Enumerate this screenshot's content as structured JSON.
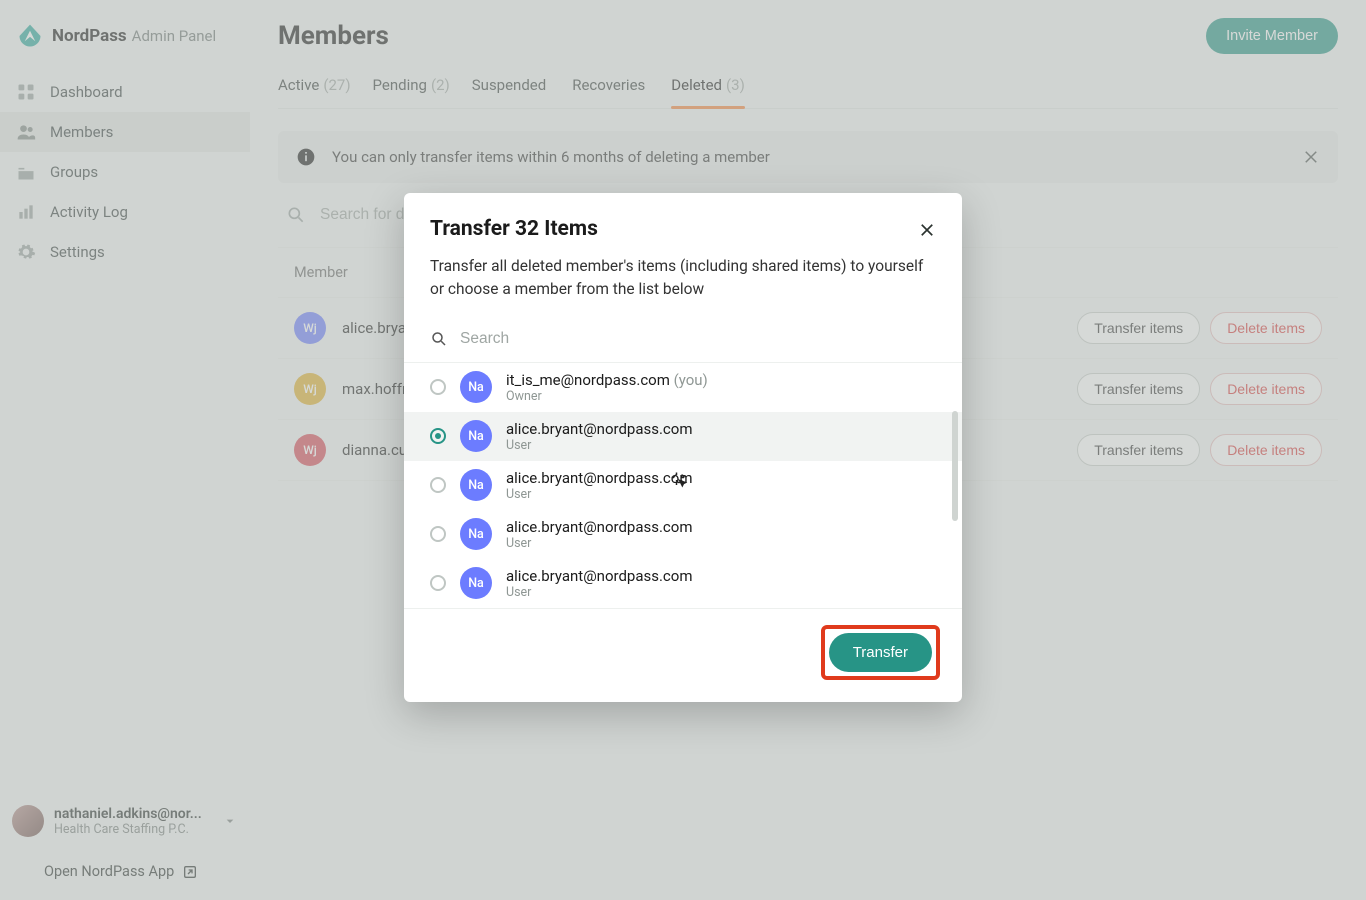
{
  "brand": {
    "name": "NordPass",
    "sub": "Admin Panel"
  },
  "nav": {
    "items": [
      {
        "label": "Dashboard"
      },
      {
        "label": "Members"
      },
      {
        "label": "Groups"
      },
      {
        "label": "Activity Log"
      },
      {
        "label": "Settings"
      }
    ]
  },
  "account": {
    "email": "nathaniel.adkins@nor...",
    "org": "Health Care Staffing P.C."
  },
  "open_app_label": "Open NordPass App",
  "page": {
    "title": "Members",
    "invite_label": "Invite Member"
  },
  "tabs": [
    {
      "label": "Active",
      "count": "(27)"
    },
    {
      "label": "Pending",
      "count": "(2)"
    },
    {
      "label": "Suspended",
      "count": ""
    },
    {
      "label": "Recoveries",
      "count": ""
    },
    {
      "label": "Deleted",
      "count": "(3)"
    }
  ],
  "banner": {
    "text": "You can only transfer items within 6 months of deleting a member"
  },
  "search": {
    "placeholder": "Search for d"
  },
  "table": {
    "header": "Member",
    "rows": [
      {
        "initials": "Wj",
        "name": "alice.brya",
        "color": "#6c7cff"
      },
      {
        "initials": "Wj",
        "name": "max.hoffm",
        "color": "#e0b02d"
      },
      {
        "initials": "Wj",
        "name": "dianna.cu",
        "color": "#d84b57"
      }
    ],
    "transfer_label": "Transfer items",
    "delete_label": "Delete items"
  },
  "modal": {
    "title": "Transfer 32 Items",
    "desc_prefix": "Transfer ",
    "desc_all": "all",
    "desc_rest": " deleted member's items (including shared items) to yourself or choose a member from the list below",
    "search_placeholder": "Search",
    "members": [
      {
        "initials": "Na",
        "email": "it_is_me@nordpass.com",
        "you": "(you)",
        "role": "Owner",
        "selected": false
      },
      {
        "initials": "Na",
        "email": "alice.bryant@nordpass.com",
        "you": "",
        "role": "User",
        "selected": true
      },
      {
        "initials": "Na",
        "email": "alice.bryant@nordpass.com",
        "you": "",
        "role": "User",
        "selected": false
      },
      {
        "initials": "Na",
        "email": "alice.bryant@nordpass.com",
        "you": "",
        "role": "User",
        "selected": false
      },
      {
        "initials": "Na",
        "email": "alice.bryant@nordpass.com",
        "you": "",
        "role": "User",
        "selected": false
      }
    ],
    "transfer_button": "Transfer"
  }
}
